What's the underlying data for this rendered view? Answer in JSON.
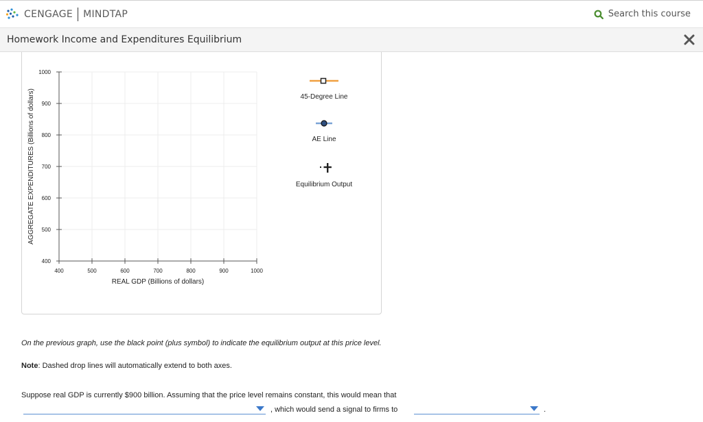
{
  "header": {
    "brand": "CENGAGE",
    "product": "MINDTAP",
    "search_label": "Search this course",
    "accent_color": "#4a8d2f"
  },
  "titlebar": {
    "title": "Homework Income and Expenditures Equilibrium",
    "close_icon": "close-x-icon"
  },
  "chart_data": {
    "type": "line",
    "title": "",
    "xlabel": "REAL GDP (Billions of dollars)",
    "ylabel": "AGGREGATE EXPENDITURES (Billions of dollars)",
    "xlim": [
      400,
      1000
    ],
    "ylim": [
      400,
      1000
    ],
    "x_ticks": [
      400,
      500,
      600,
      700,
      800,
      900,
      1000
    ],
    "y_ticks": [
      400,
      500,
      600,
      700,
      800,
      900,
      1000
    ],
    "grid": true,
    "series": []
  },
  "legend": {
    "items": [
      {
        "label": "45-Degree Line",
        "icon": "square-marker-line-icon",
        "color": "#f0a040"
      },
      {
        "label": "AE Line",
        "icon": "circle-marker-line-icon",
        "color": "#7aa3d6"
      },
      {
        "label": "Equilibrium Output",
        "icon": "plus-marker-icon",
        "color": "#222222"
      }
    ]
  },
  "question": {
    "instructions": "On the previous graph, use the black point (plus symbol) to indicate the equilibrium output at this price level.",
    "note_label": "Note",
    "note_text": ": Dashed drop lines will automatically extend to both axes.",
    "prompt": "Suppose real GDP is currently $900 billion. Assuming that the price level remains constant, this would mean that",
    "dropdown1_value": "",
    "mid_text": ", which would send a signal to firms to",
    "dropdown2_value": "",
    "end_text": "."
  }
}
